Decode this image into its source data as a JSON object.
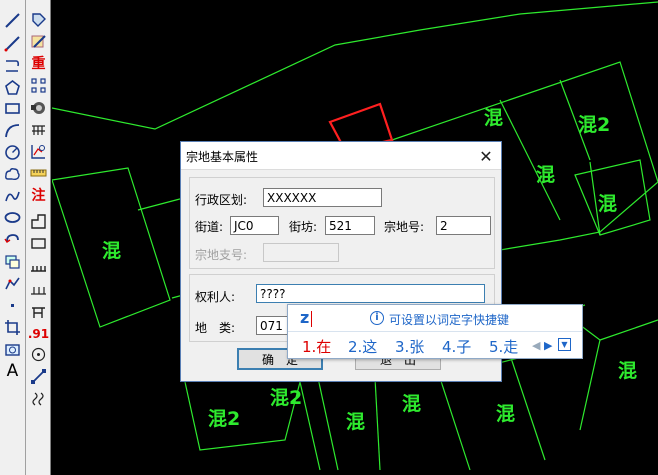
{
  "toolbar_left": {
    "tools": [
      "line-tool-icon",
      "polyline-tool-icon",
      "arc-tool-icon",
      "polygon-tool-icon",
      "rectangle-tool-icon",
      "curve-tool-icon",
      "circle-tool-icon",
      "cloud-tool-icon",
      "spline-tool-icon",
      "ellipse-tool-icon",
      "rotate-tool-icon",
      "layers-tool-icon",
      "measure-tool-icon",
      "point-tool-icon",
      "clip-tool-icon",
      "shape-tool-icon",
      "text-tool-icon"
    ]
  },
  "toolbar_right": {
    "tools": [
      "edit-vertex-icon",
      "paint-icon",
      "redraw-label",
      "node-grid-icon",
      "camera-icon",
      "ladder-icon",
      "chart-edit-icon",
      "ruler-icon",
      "note-label",
      "stair-shape-icon",
      "rect-outline-icon",
      "comb-icon",
      "dashed-line-icon",
      "gate-icon",
      "elevation-label",
      "target-icon",
      "diagonal-tool-icon",
      "break-symbol-icon"
    ],
    "redraw_label": "重",
    "note_label": "注",
    "elevation_label": ".91",
    "text_tool_label": "A"
  },
  "canvas": {
    "labels": [
      "混",
      "混",
      "混2",
      "混",
      "混",
      "混",
      "混",
      "混2",
      "混2",
      "混",
      "混",
      "混",
      "混"
    ]
  },
  "dialog": {
    "title": "宗地基本属性",
    "district_label": "行政区划:",
    "district_value": "XXXXXX",
    "street_label": "街道:",
    "street_value": "JC0",
    "block_label": "街坊:",
    "block_value": "521",
    "parcel_no_label": "宗地号:",
    "parcel_no_value": "2",
    "sub_parcel_label": "宗地支号:",
    "sub_parcel_value": "",
    "owner_label": "权利人:",
    "owner_value": "????",
    "land_class_label": "地　类:",
    "land_class_value": "071",
    "ok_label": "确　定",
    "cancel_label": "退　出"
  },
  "ime": {
    "composition": "z",
    "hint": "可设置以词定字快捷键",
    "candidates": [
      "1.在",
      "2.这",
      "3.张",
      "4.子",
      "5.走"
    ],
    "selected_index": 0
  }
}
